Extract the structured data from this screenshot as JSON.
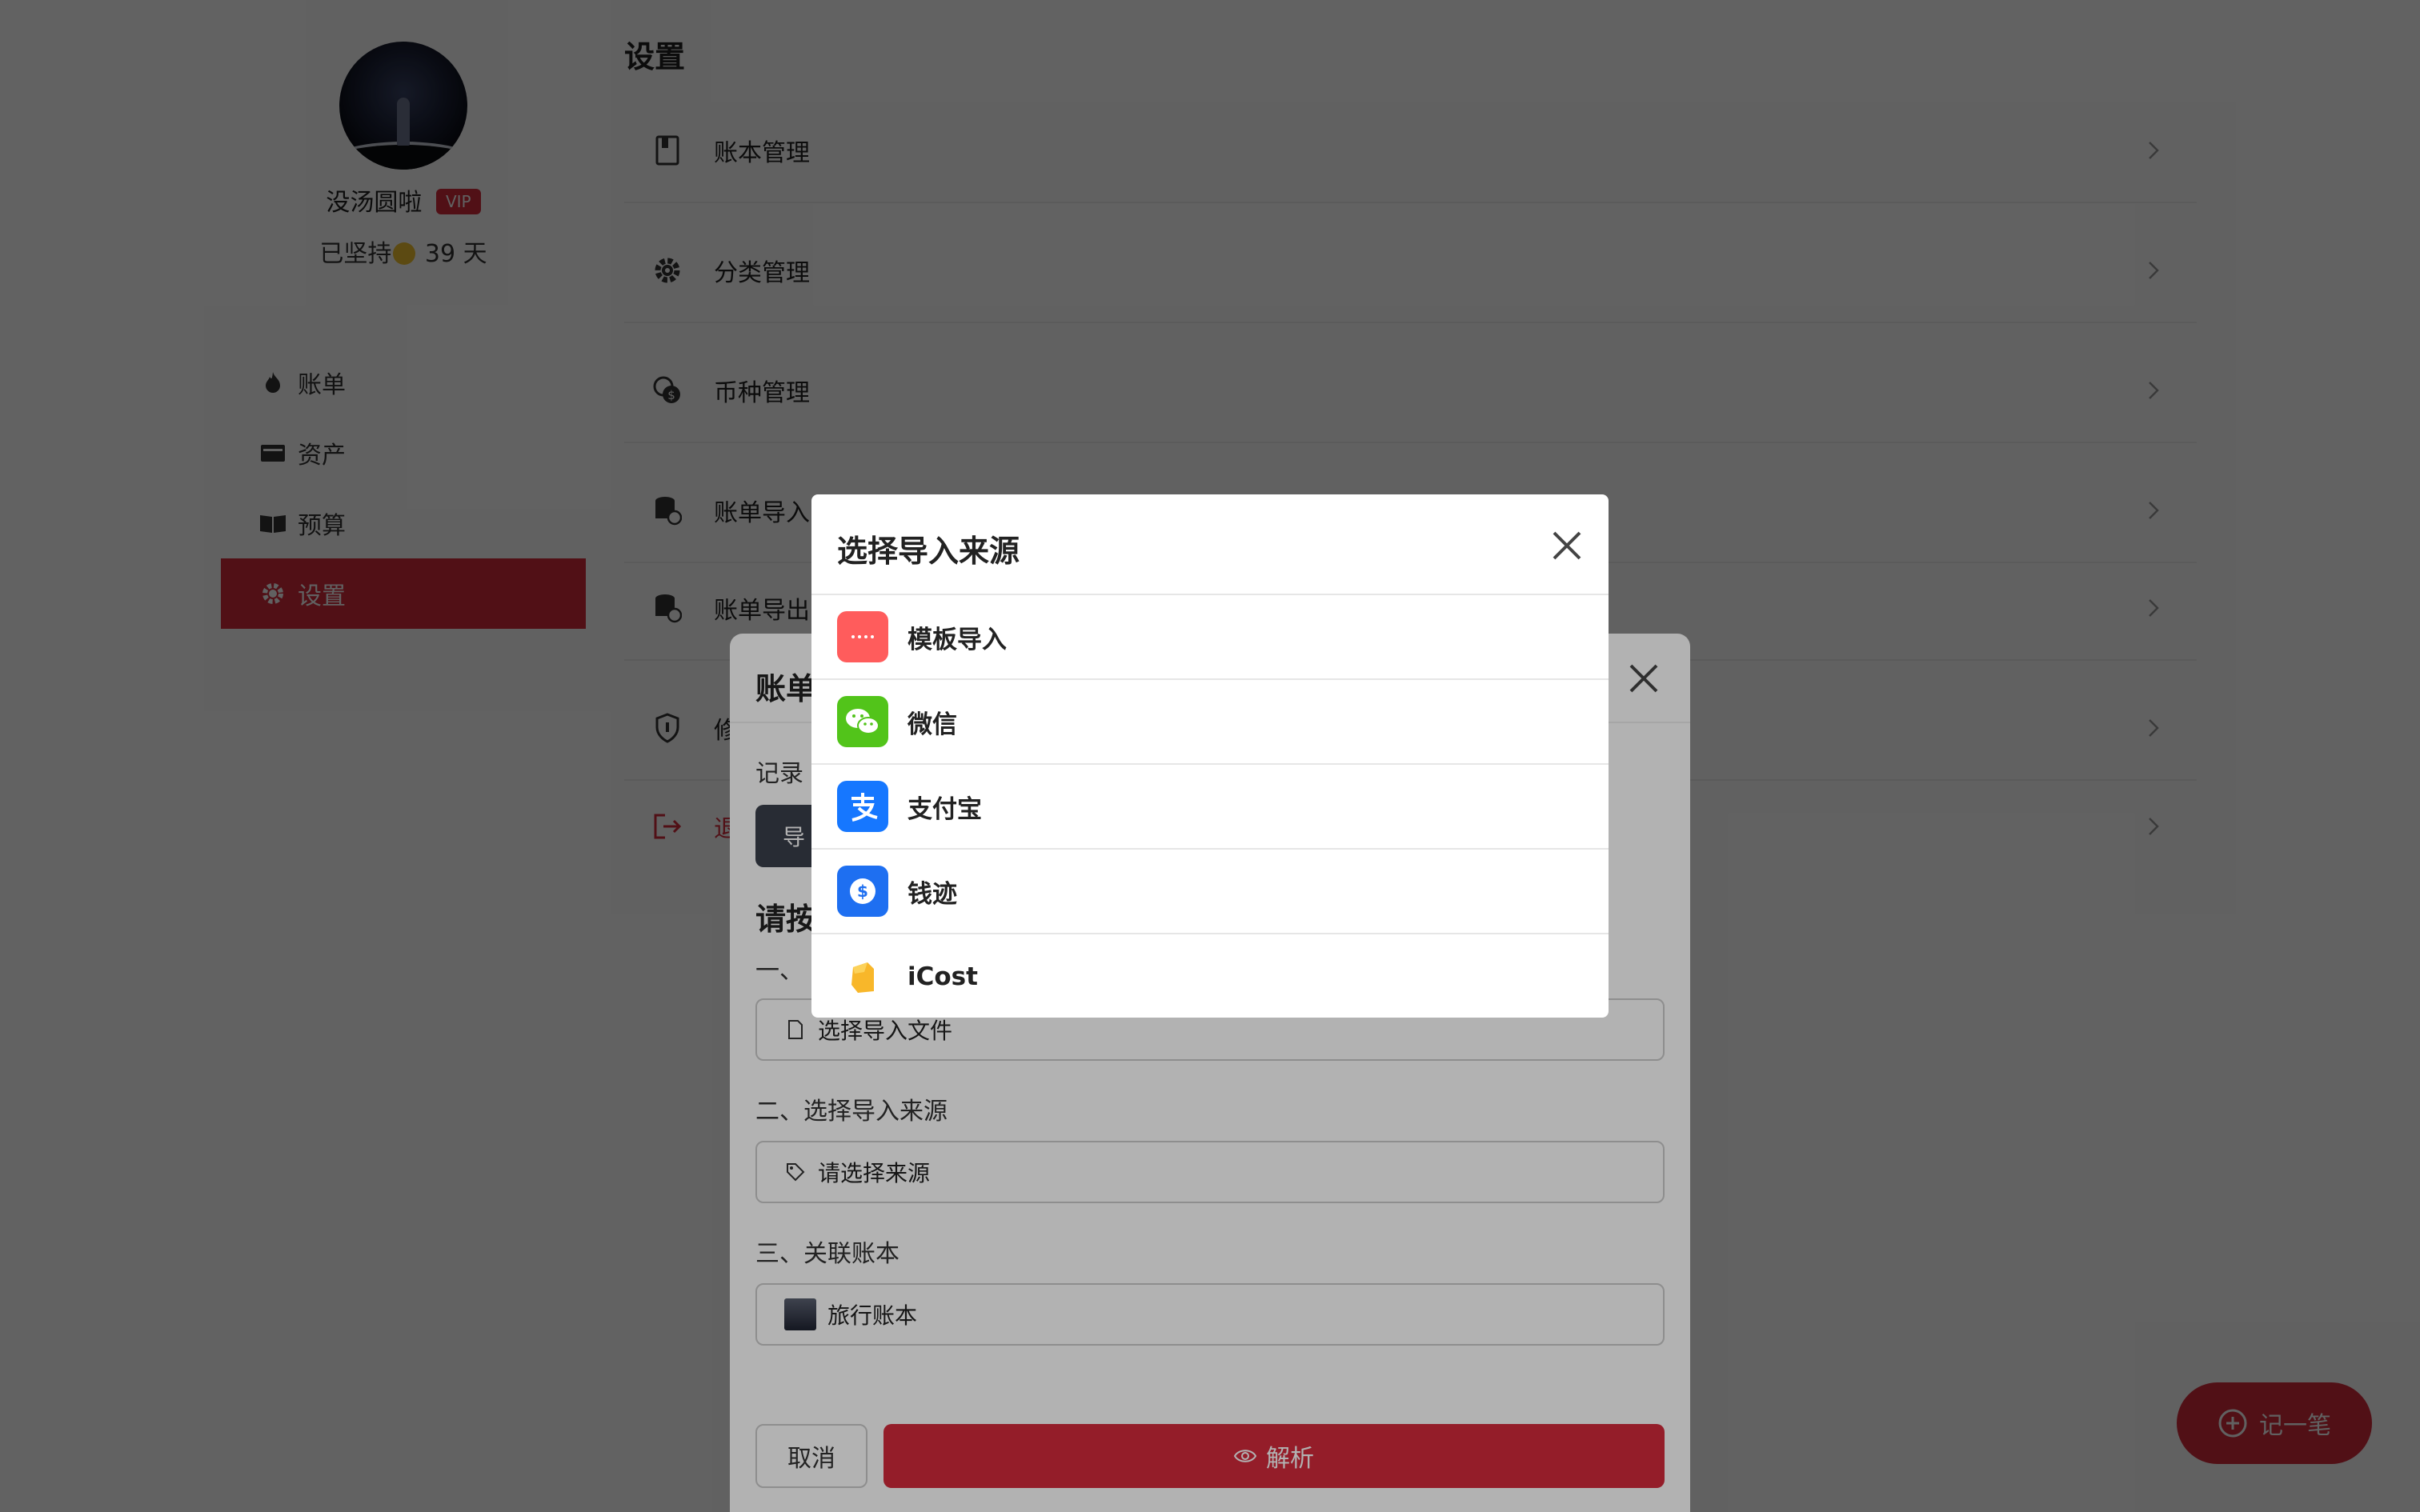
{
  "profile": {
    "username": "没汤圆啦",
    "vip_label": "VIP",
    "streak_prefix": "已坚持",
    "streak_days": "39 天"
  },
  "nav": {
    "items": [
      {
        "label": "账单"
      },
      {
        "label": "资产"
      },
      {
        "label": "预算"
      },
      {
        "label": "设置"
      }
    ]
  },
  "settings": {
    "title": "设置",
    "rows": [
      {
        "label": "账本管理"
      },
      {
        "label": "分类管理"
      },
      {
        "label": "币种管理"
      },
      {
        "label": "账单导入"
      },
      {
        "label": "账单导出"
      },
      {
        "label": "修"
      },
      {
        "label": "退"
      }
    ]
  },
  "fab": {
    "label": "记一笔"
  },
  "import_dialog": {
    "title": "账单",
    "record_label": "记录",
    "import_button": "导",
    "guide_title": "请按",
    "step1_label": "一、",
    "file_placeholder": "选择导入文件",
    "step2_label": "二、选择导入来源",
    "source_placeholder": "请选择来源",
    "step3_label": "三、关联账本",
    "ledger_value": "旅行账本",
    "cancel_label": "取消",
    "parse_label": "解析"
  },
  "source_picker": {
    "title": "选择导入来源",
    "options": [
      {
        "label": "模板导入",
        "icon": "template-icon",
        "color": "#ff5c5c"
      },
      {
        "label": "微信",
        "icon": "wechat-icon",
        "color": "#52c41a"
      },
      {
        "label": "支付宝",
        "icon": "alipay-icon",
        "color": "#1677ff"
      },
      {
        "label": "钱迹",
        "icon": "qianji-icon",
        "color": "#1e6ff1"
      },
      {
        "label": "iCost",
        "icon": "icost-icon",
        "color": "#f8b72a"
      }
    ]
  },
  "colors": {
    "accent": "#d42a3b",
    "dark_button": "#3a3f4b"
  }
}
